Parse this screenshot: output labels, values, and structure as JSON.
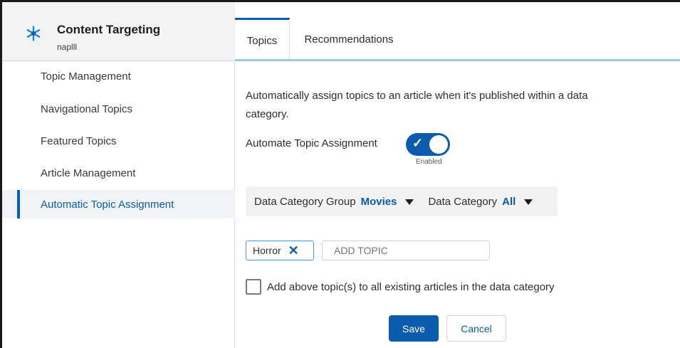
{
  "app": {
    "title": "Content Targeting",
    "subtitle": "naplll",
    "icon": "asterisk-icon",
    "accent_color": "#0b5cad"
  },
  "sidebar": {
    "items": [
      {
        "label": "Topic Management",
        "active": false
      },
      {
        "label": "Navigational Topics",
        "active": false
      },
      {
        "label": "Featured Topics",
        "active": false
      },
      {
        "label": "Article Management",
        "active": false
      },
      {
        "label": "Automatic Topic Assignment",
        "active": true
      }
    ]
  },
  "tabs": [
    {
      "label": "Topics",
      "active": true
    },
    {
      "label": "Recommendations",
      "active": false
    }
  ],
  "main": {
    "description": "Automatically assign topics to an article when it's published within a data category.",
    "toggle": {
      "label": "Automate Topic Assignment",
      "status": "Enabled",
      "on": true
    },
    "filters": {
      "group_label": "Data Category Group",
      "group_value": "Movies",
      "category_label": "Data Category",
      "category_value": "All"
    },
    "topics": [
      {
        "label": "Horror"
      }
    ],
    "add_topic_placeholder": "ADD TOPIC",
    "checkbox": {
      "label": "Add above topic(s) to all existing articles in the data category",
      "checked": false
    },
    "buttons": {
      "save": "Save",
      "cancel": "Cancel"
    }
  }
}
